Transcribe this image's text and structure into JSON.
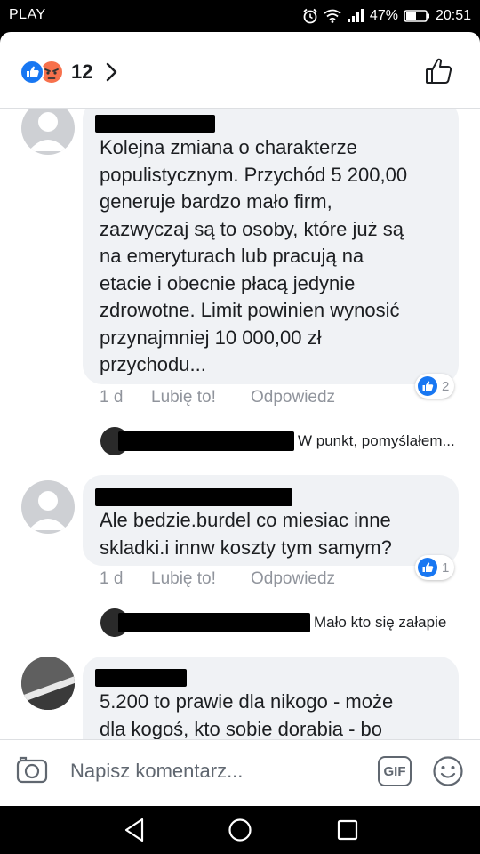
{
  "status_bar": {
    "carrier": "PLAY",
    "battery": "47%",
    "time": "20:51"
  },
  "header": {
    "reaction_count": "12"
  },
  "comments": [
    {
      "lines": [
        "Kolejna zmiana o charakterze",
        "populistycznym. Przychód 5 200,00",
        "generuje bardzo mało firm,",
        "zazwyczaj są to osoby, które już są",
        "na emeryturach lub pracują na",
        "etacie i obecnie płacą jedynie",
        "zdrowotne. Limit powinien wynosić",
        "przynajmniej 10 000,00 zł",
        "przychodu..."
      ],
      "time": "1 d",
      "like_label": "Lubię to!",
      "reply_label": "Odpowiedz",
      "like_count": "2",
      "reply_preview": "W punkt, pomyślałem..."
    },
    {
      "lines": [
        "Ale bedzie.burdel co miesiac inne",
        "skladki.i innw koszty tym samym?"
      ],
      "time": "1 d",
      "like_label": "Lubię to!",
      "reply_label": "Odpowiedz",
      "like_count": "1",
      "reply_preview": "Mało kto się załapie"
    },
    {
      "lines": [
        "5.200 to prawie dla nikogo - może",
        "dla kogoś, kto sobie dorabia - bo"
      ]
    }
  ],
  "composer": {
    "placeholder": "Napisz komentarz...",
    "gif_label": "GIF"
  },
  "icons": {
    "like": "like-reaction-icon",
    "angry": "angry-reaction-icon",
    "thumb": "thumbs-up-outline-icon",
    "camera": "camera-icon",
    "emoji": "emoji-icon"
  },
  "colors": {
    "facebook_blue": "#1877f2",
    "angry_orange": "#f7714c",
    "bubble_gray": "#f0f2f5",
    "meta_gray": "#90949c"
  }
}
